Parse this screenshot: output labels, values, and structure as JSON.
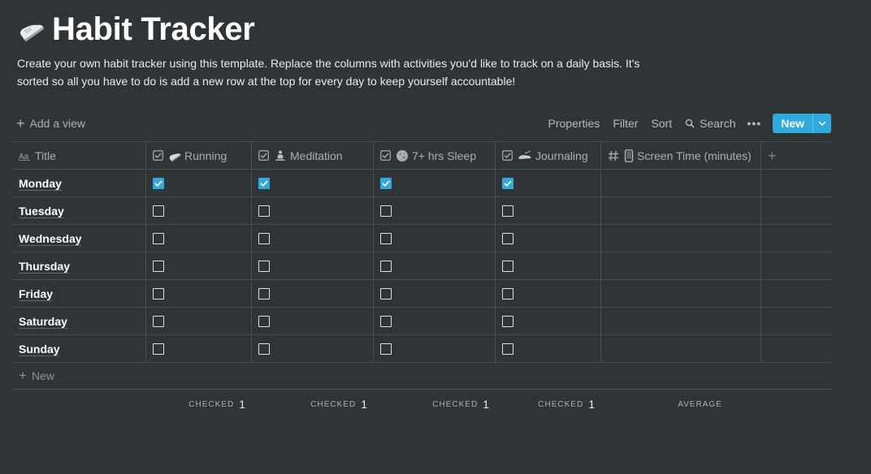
{
  "page": {
    "title": "Habit Tracker",
    "title_icon": "running-shoe-icon",
    "description": "Create your own habit tracker using this template. Replace the columns with activities you'd like to track on a daily basis. It's sorted so all you have to do is add a new row at the top for every day to keep yourself accountable!"
  },
  "toolbar": {
    "add_view_label": "Add a view",
    "properties_label": "Properties",
    "filter_label": "Filter",
    "sort_label": "Sort",
    "search_label": "Search",
    "more_label": "•••",
    "new_label": "New"
  },
  "columns": [
    {
      "label": "Title",
      "icon": "text-property-icon"
    },
    {
      "label": "Running",
      "icon": "checkbox-property-icon",
      "emoji": "running-shoe-icon"
    },
    {
      "label": "Meditation",
      "icon": "checkbox-property-icon",
      "emoji": "meditation-icon"
    },
    {
      "label": "7+ hrs Sleep",
      "icon": "checkbox-property-icon",
      "emoji": "moon-icon"
    },
    {
      "label": "Journaling",
      "icon": "checkbox-property-icon",
      "emoji": "writing-hand-icon"
    },
    {
      "label": "Screen Time (minutes)",
      "icon": "number-property-icon",
      "emoji": "mobile-phone-icon"
    }
  ],
  "rows": [
    {
      "title": "Monday",
      "running": true,
      "meditation": true,
      "sleep": true,
      "journaling": true,
      "screen_time": ""
    },
    {
      "title": "Tuesday",
      "running": false,
      "meditation": false,
      "sleep": false,
      "journaling": false,
      "screen_time": ""
    },
    {
      "title": "Wednesday",
      "running": false,
      "meditation": false,
      "sleep": false,
      "journaling": false,
      "screen_time": ""
    },
    {
      "title": "Thursday",
      "running": false,
      "meditation": false,
      "sleep": false,
      "journaling": false,
      "screen_time": ""
    },
    {
      "title": "Friday",
      "running": false,
      "meditation": false,
      "sleep": false,
      "journaling": false,
      "screen_time": ""
    },
    {
      "title": "Saturday",
      "running": false,
      "meditation": false,
      "sleep": false,
      "journaling": false,
      "screen_time": ""
    },
    {
      "title": "Sunday",
      "running": false,
      "meditation": false,
      "sleep": false,
      "journaling": false,
      "screen_time": ""
    }
  ],
  "new_row_label": "New",
  "calculations": {
    "running": {
      "label": "CHECKED",
      "value": "1"
    },
    "meditation": {
      "label": "CHECKED",
      "value": "1"
    },
    "sleep": {
      "label": "CHECKED",
      "value": "1"
    },
    "journaling": {
      "label": "CHECKED",
      "value": "1"
    },
    "screen_time": {
      "label": "AVERAGE",
      "value": ""
    }
  },
  "colors": {
    "background": "#2f3437",
    "accent": "#2eaadc",
    "divider": "rgba(255,255,255,0.13)"
  }
}
